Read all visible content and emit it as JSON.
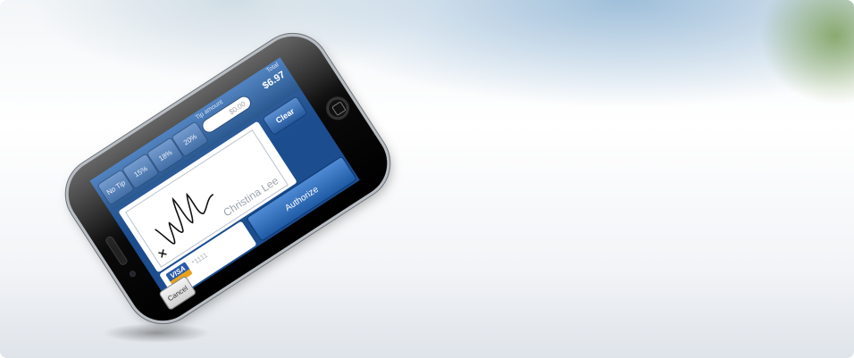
{
  "tip": {
    "options": [
      "No Tip",
      "15%",
      "18%",
      "20%"
    ],
    "amount_label": "Tip amount",
    "amount_placeholder": "$0.00"
  },
  "total": {
    "label": "Total",
    "value": "$6.97"
  },
  "signature": {
    "signer_name": "Christina Lee",
    "x_mark": "✕"
  },
  "buttons": {
    "clear": "Clear",
    "authorize": "Authorize",
    "cancel": "Cancel"
  },
  "card": {
    "brand": "VISA",
    "masked_number": "*1111"
  },
  "icons": {
    "card_brand": "visa-icon",
    "home": "home-button-icon"
  }
}
